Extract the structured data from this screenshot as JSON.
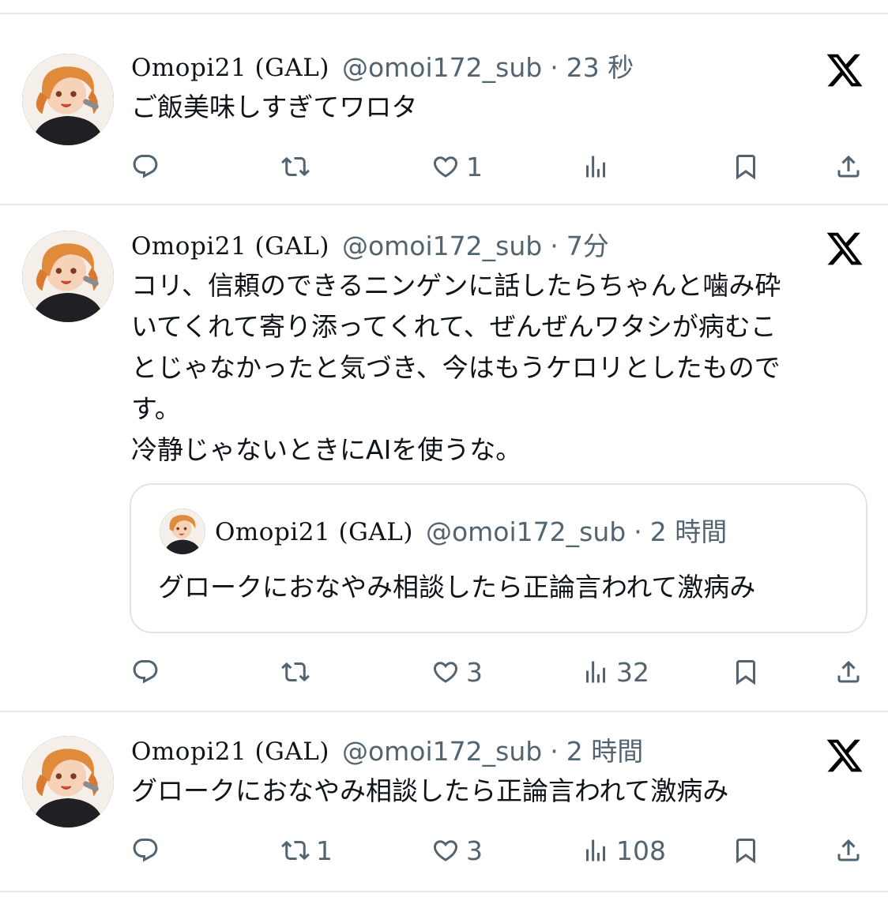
{
  "tweets": [
    {
      "name": "Omopi21 (GAL)",
      "handle": "@omoi172_sub",
      "sep": "·",
      "time": "23 秒",
      "text": "ご飯美味しすぎてワロタ",
      "reply_count": "",
      "retweet_count": "",
      "like_count": "1",
      "view_count": ""
    },
    {
      "name": "Omopi21 (GAL)",
      "handle": "@omoi172_sub",
      "sep": "·",
      "time": "7分",
      "text": "コリ、信頼のできるニンゲンに話したらちゃんと噛み砕\nいてくれて寄り添ってくれて、ぜんぜんワタシが病むこ\nとじゃなかったと気づき、今はもうケロリとしたもので\nす。\n冷静じゃないときにAIを使うな。",
      "quote": {
        "name": "Omopi21 (GAL)",
        "handle": "@omoi172_sub",
        "sep": "·",
        "time": "2 時間",
        "text": "グロークにおなやみ相談したら正論言われて激病み"
      },
      "reply_count": "",
      "retweet_count": "",
      "like_count": "3",
      "view_count": "32"
    },
    {
      "name": "Omopi21 (GAL)",
      "handle": "@omoi172_sub",
      "sep": "·",
      "time": "2 時間",
      "text": "グロークにおなやみ相談したら正論言われて激病み",
      "reply_count": "",
      "retweet_count": "1",
      "like_count": "3",
      "view_count": "108"
    }
  ],
  "icons": {
    "brand": "x-logo-icon",
    "reply": "reply-icon",
    "retweet": "retweet-icon",
    "like": "heart-icon",
    "views": "views-icon",
    "bookmark": "bookmark-icon",
    "share": "share-icon"
  },
  "colors": {
    "text": "#0f1419",
    "secondary": "#536471",
    "divider": "#e6e9ec",
    "quote_border": "#dfe4e8"
  }
}
